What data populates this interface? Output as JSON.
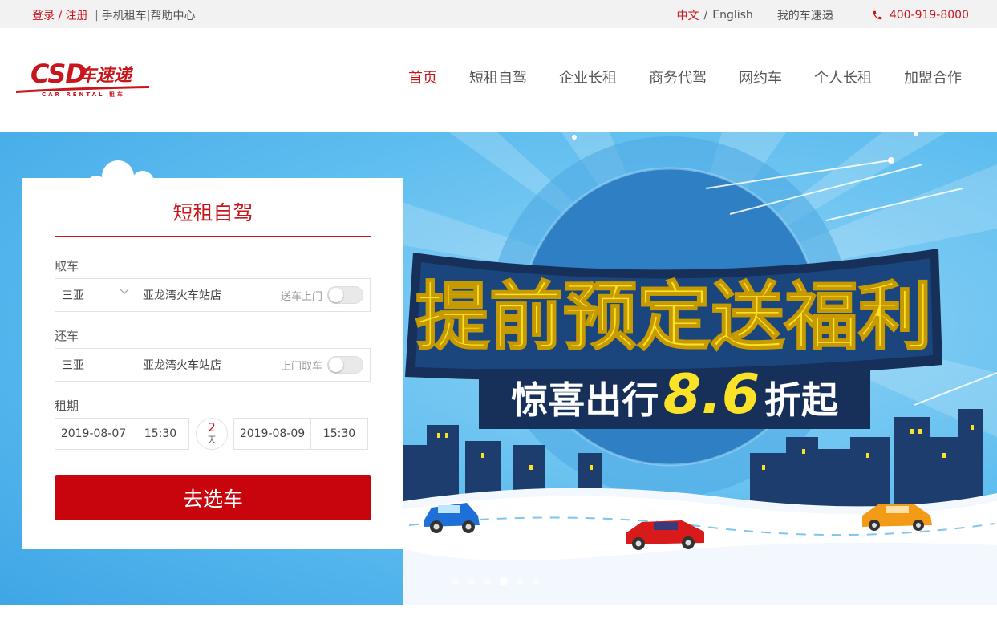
{
  "topbar": {
    "login": "登录 / 注册",
    "mobile_rental": "手机租车",
    "help_center": "帮助中心",
    "lang_cn": "中文",
    "lang_slash": "/",
    "lang_en": "English",
    "my_account": "我的车速递",
    "phone": "400-919-8000"
  },
  "logo": {
    "main": "CSD车速递",
    "sub": "CAR RENTAL 租车"
  },
  "nav": {
    "items": [
      {
        "label": "首页",
        "active": true
      },
      {
        "label": "短租自驾"
      },
      {
        "label": "企业长租"
      },
      {
        "label": "商务代驾"
      },
      {
        "label": "网约车"
      },
      {
        "label": "个人长租"
      },
      {
        "label": "加盟合作"
      }
    ]
  },
  "booking": {
    "title": "短租自驾",
    "pickup_label": "取车",
    "pickup_city": "三亚",
    "pickup_store": "亚龙湾火车站店",
    "pickup_option": "送车上门",
    "return_label": "还车",
    "return_city": "三亚",
    "return_store": "亚龙湾火车站店",
    "return_option": "上门取车",
    "period_label": "租期",
    "start_date": "2019-08-07",
    "start_time": "15:30",
    "days_count": "2",
    "days_unit": "天",
    "end_date": "2019-08-09",
    "end_time": "15:30",
    "submit": "去选车"
  },
  "banner": {
    "headline": "提前预定送福利",
    "subline_prefix": "惊喜出行",
    "subline_number": "8.6",
    "subline_suffix": "折起",
    "slide_count": 6,
    "active_slide": 4
  },
  "colors": {
    "brand_red": "#c8161d",
    "sky": "#5cbcef",
    "headline_yellow": "#fbe226",
    "ribbon_navy": "#16305a"
  }
}
